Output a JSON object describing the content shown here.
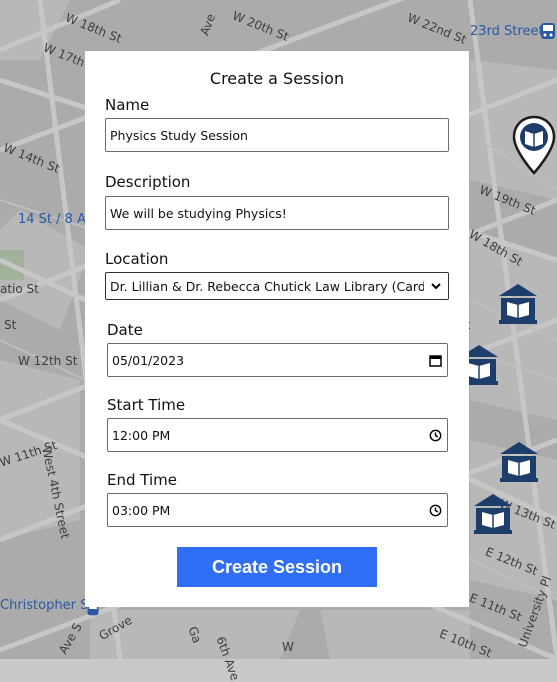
{
  "map": {
    "labels": {
      "w18": "W 18th St",
      "w20": "W 20th St",
      "w22": "W 22nd St",
      "street23": "23rd Street",
      "w17": "W 17th",
      "ave": "Ave",
      "w14": "W 14th St",
      "w19": "W 19th St",
      "s14": "14 St / 8 Av",
      "w18b": "W 18th St",
      "atio": "atio St",
      "st": "St",
      "w12": "W 12th St",
      "west4": "West 4th Street",
      "w11": "W 11th St",
      "w13": "W 13th St",
      "e12": "E 12th St",
      "christopher": "Christopher St",
      "e11": "E 11th St",
      "e10": "E 10th St",
      "grove": "Grove",
      "ave6": "6th Ave",
      "university": "University Pl",
      "aves": "Ave S",
      "ga": "Ga",
      "w": "W"
    }
  },
  "form": {
    "title": "Create a Session",
    "name_label": "Name",
    "name_value": "Physics Study Session",
    "description_label": "Description",
    "description_value": "We will be studying Physics!",
    "location_label": "Location",
    "location_value": "Dr. Lillian & Dr. Rebecca Chutick Law Library (Cardozo Law)",
    "date_label": "Date",
    "date_value": "05/01/2023",
    "start_label": "Start Time",
    "start_value": "12:00 PM",
    "end_label": "End Time",
    "end_value": "03:00 PM",
    "submit_label": "Create Session"
  },
  "colors": {
    "accent": "#2f6ef5",
    "pin": "#1d3d6b"
  }
}
